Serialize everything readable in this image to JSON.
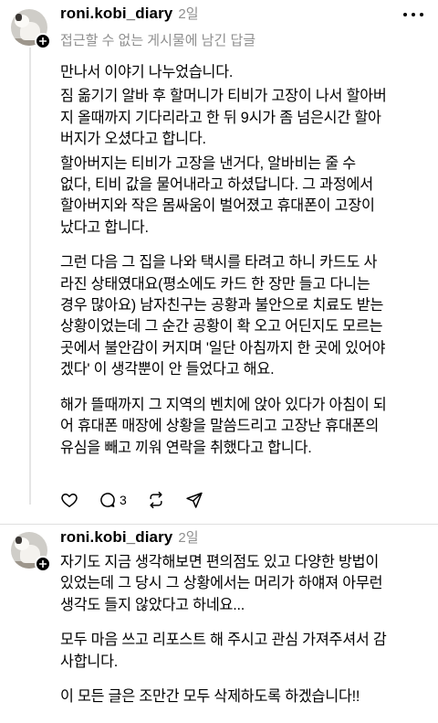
{
  "post1": {
    "username": "roni.kobi_diary",
    "time": "2일",
    "reply_note": "접근할 수 없는 게시물에 남긴 답글",
    "paragraphs": [
      [
        "만나서 이야기 나누었습니다.",
        "짐 옮기기 알바 후 할머니가 티비가 고장이 나서 할아버",
        "지 올때까지 기다리라고 한 뒤 9시가 좀 넘은시간 할아",
        "버지가 오셨다고 합니다."
      ],
      [
        "할아버지는 티비가 고장을 낸거다, 알바비는 줄 수",
        "없다, 티비 값을 물어내라고 하셨답니다. 그 과정에서",
        "할아버지와 작은 몸싸움이 벌어졌고 휴대폰이 고장이",
        "났다고 합니다."
      ],
      [
        "그런 다음 그 집을 나와 택시를 타려고 하니 카드도 사",
        "라진 상태였대요(평소에도 카드 한 장만 들고 다니는",
        "경우 많아요) 남자친구는 공황과 불안으로 치료도 받는",
        "상황이었는데 그 순간 공황이 확 오고 어딘지도 모르는",
        "곳에서 불안감이 커지며 '일단 아침까지 한 곳에 있어야",
        "겠다' 이 생각뿐이 안 들었다고 해요."
      ],
      [
        "해가 뜰때까지 그 지역의 벤치에 앉아 있다가 아침이 되",
        "어 휴대폰 매장에 상황을 말씀드리고 고장난 휴대폰의",
        "유심을 빼고 끼워 연락을 취했다고 합니다."
      ]
    ],
    "actions": {
      "reply_count": "3"
    }
  },
  "post2": {
    "username": "roni.kobi_diary",
    "time": "2일",
    "paragraphs": [
      [
        "자기도 지금 생각해보면 편의점도 있고 다양한 방법이",
        "있었는데 그 당시 그 상황에서는 머리가 하얘져 아무런",
        "생각도 들지 않았다고 하네요..."
      ],
      [
        "모두 마음 쓰고 리포스트 해 주시고 관심 가져주셔서 감",
        "사합니다."
      ],
      [
        "이 모든 글은 조만간 모두 삭제하도록 하겠습니다!!"
      ]
    ]
  },
  "icons": {
    "more": "more-horizontal-icon",
    "like": "heart-icon",
    "reply": "comment-icon",
    "repost": "repost-icon",
    "share": "send-icon",
    "follow": "plus-icon"
  }
}
